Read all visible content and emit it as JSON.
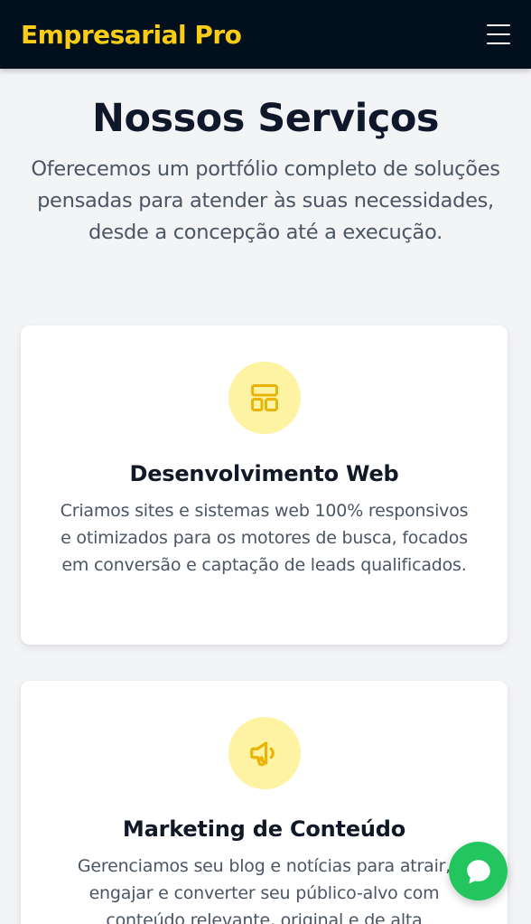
{
  "header": {
    "brand": "Empresarial Pro",
    "menu_icon": "hamburger-menu-icon"
  },
  "hero": {
    "title": "Nossos Serviços",
    "subtitle": "Oferecemos um portfólio completo de soluções pensadas para atender às suas necessidades, desde a concepção até a execução."
  },
  "services": [
    {
      "icon": "layout-icon",
      "title": "Desenvolvimento Web",
      "description": "Criamos sites e sistemas web 100% responsivos e otimizados para os motores de busca, focados em conversão e captação de leads qualificados."
    },
    {
      "icon": "megaphone-icon",
      "title": "Marketing de Conteúdo",
      "description": "Gerenciamos seu blog e notícias para atrair, engajar e converter seu público-alvo com conteúdo relevante, original e de alta"
    }
  ],
  "chat": {
    "icon": "chat-bubble-icon"
  },
  "colors": {
    "header_bg": "#020f1c",
    "brand_accent": "#facc15",
    "icon_circle": "#fef3a3",
    "chat_button": "#22c55e",
    "page_bg": "#f3f4f6"
  }
}
